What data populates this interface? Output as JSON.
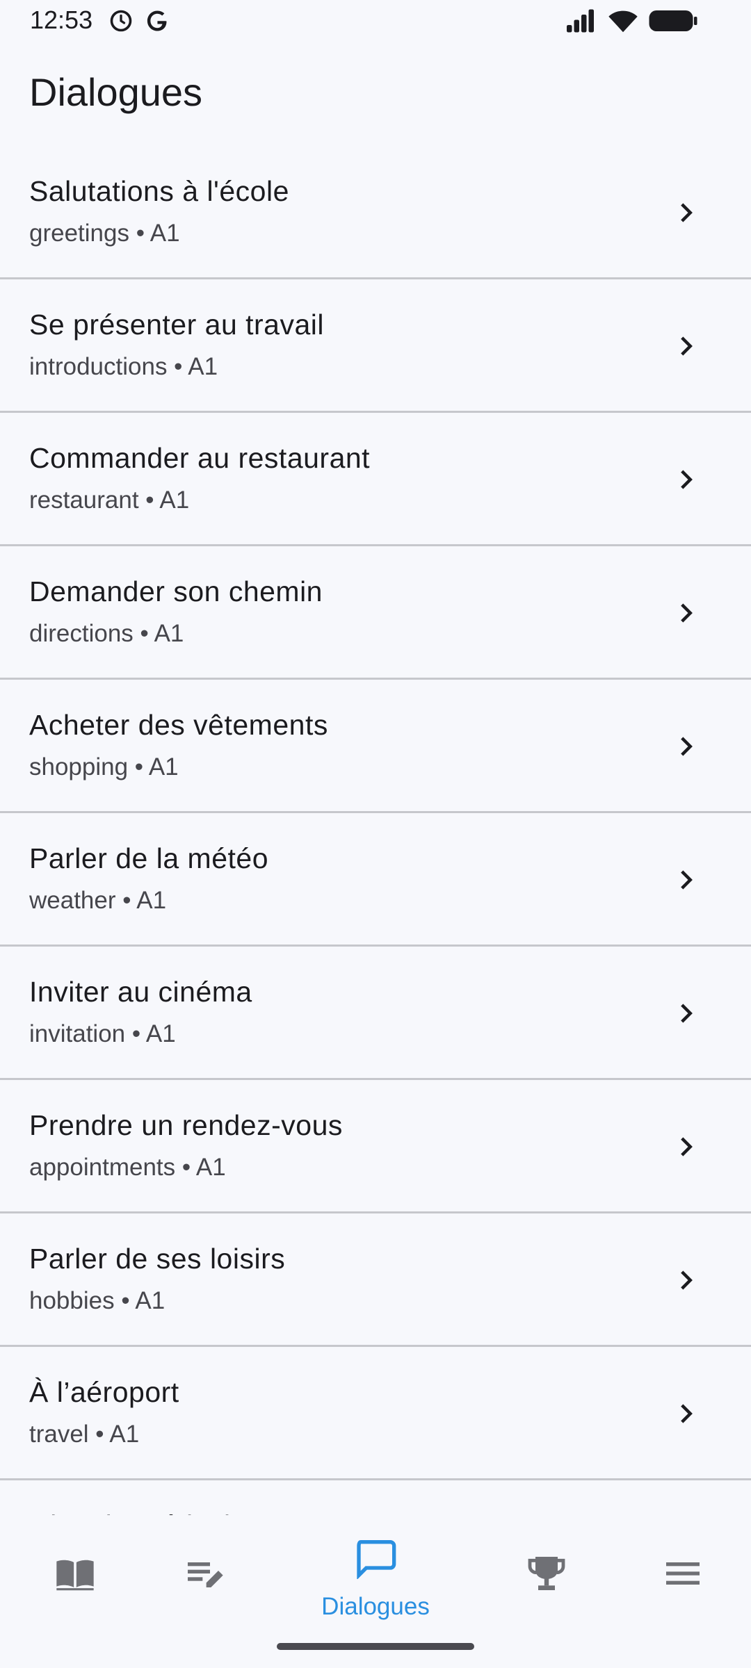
{
  "status_bar": {
    "time": "12:53",
    "left_icons": [
      "alarm-clock-icon",
      "google-icon"
    ],
    "right_icons": [
      "signal-icon",
      "wifi-icon",
      "battery-icon"
    ]
  },
  "header": {
    "title": "Dialogues"
  },
  "dialogues": [
    {
      "title": "Salutations à l'école",
      "subtitle": "greetings • A1"
    },
    {
      "title": "Se présenter au travail",
      "subtitle": "introductions • A1"
    },
    {
      "title": "Commander au restaurant",
      "subtitle": "restaurant • A1"
    },
    {
      "title": "Demander son chemin",
      "subtitle": "directions • A1"
    },
    {
      "title": "Acheter des vêtements",
      "subtitle": "shopping • A1"
    },
    {
      "title": "Parler de la météo",
      "subtitle": "weather • A1"
    },
    {
      "title": "Inviter au cinéma",
      "subtitle": "invitation • A1"
    },
    {
      "title": "Prendre un rendez-vous",
      "subtitle": "appointments • A1"
    },
    {
      "title": "Parler de ses loisirs",
      "subtitle": "hobbies • A1"
    },
    {
      "title": "À l’aéroport",
      "subtitle": "travel • A1"
    },
    {
      "title": "Chez le médecin",
      "subtitle": ""
    }
  ],
  "bottom_nav": {
    "items": [
      {
        "icon": "book-icon",
        "label": ""
      },
      {
        "icon": "edit-notes-icon",
        "label": ""
      },
      {
        "icon": "chat-bubble-icon",
        "label": "Dialogues"
      },
      {
        "icon": "trophy-icon",
        "label": ""
      },
      {
        "icon": "menu-icon",
        "label": ""
      }
    ],
    "active_index": 2
  },
  "colors": {
    "background": "#f7f8fc",
    "text": "#1b1b1f",
    "subtext": "#46464c",
    "divider": "#c6c7cc",
    "accent": "#2a8fe0",
    "nav_icon_inactive": "#6f7075"
  }
}
